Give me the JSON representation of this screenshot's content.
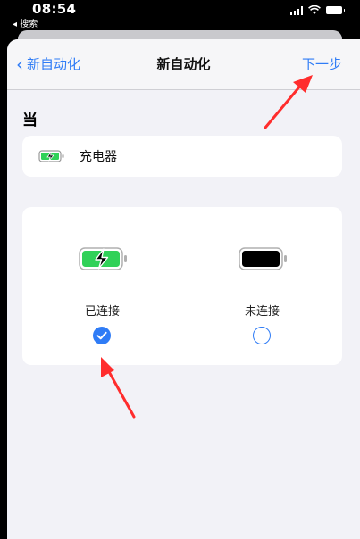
{
  "status_bar": {
    "time": "08:54",
    "back_label": "◂ 搜索"
  },
  "nav": {
    "back_label": "新自动化",
    "title": "新自动化",
    "next_label": "下一步"
  },
  "section": {
    "header": "当"
  },
  "charger": {
    "label": "充电器"
  },
  "options": [
    {
      "label": "已连接",
      "selected": true
    },
    {
      "label": "未连接",
      "selected": false
    }
  ],
  "colors": {
    "accent": "#2f7cf6",
    "battery_green": "#30d158",
    "annotation_arrow": "#ff2d2d"
  }
}
